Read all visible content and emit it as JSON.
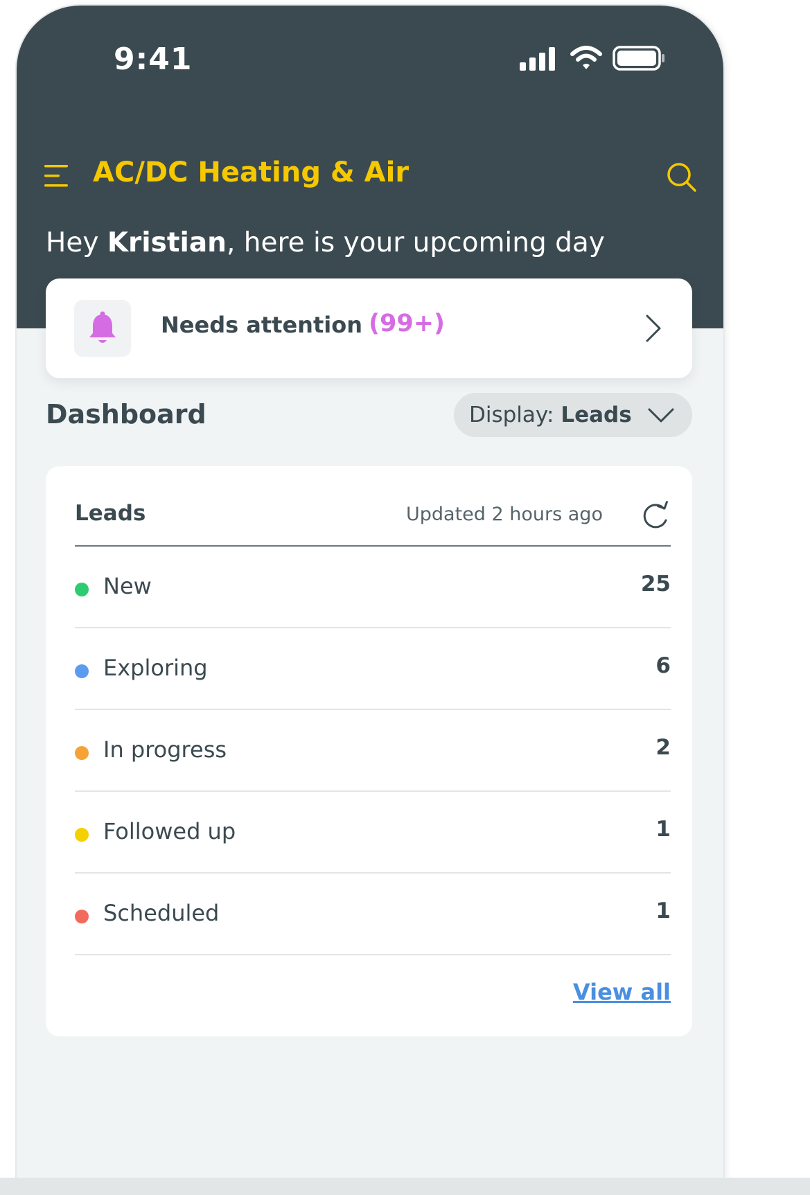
{
  "status_bar": {
    "time": "9:41"
  },
  "header": {
    "app_title": "AC/DC Heating & Air",
    "greeting_prefix": "Hey ",
    "greeting_name": "Kristian",
    "greeting_suffix": ", here is your upcoming day"
  },
  "attention": {
    "label": "Needs attention",
    "count": "(99+)"
  },
  "dashboard": {
    "title": "Dashboard",
    "display_prefix": "Display: ",
    "display_value": "Leads"
  },
  "leads_card": {
    "title": "Leads",
    "updated": "Updated 2 hours ago",
    "rows": [
      {
        "label": "New",
        "count": "25",
        "color": "#2ecc71"
      },
      {
        "label": "Exploring",
        "count": "6",
        "color": "#5b9cf0"
      },
      {
        "label": "In progress",
        "count": "2",
        "color": "#f7a234"
      },
      {
        "label": "Followed up",
        "count": "1",
        "color": "#f5d000"
      },
      {
        "label": "Scheduled",
        "count": "1",
        "color": "#f26a5e"
      }
    ],
    "view_all": "View all"
  },
  "colors": {
    "header_bg": "#3b4a50",
    "brand_yellow": "#f5c800",
    "attention_pink": "#d66ce4",
    "link_blue": "#4a8fe0"
  },
  "icons": [
    "signal-icon",
    "wifi-icon",
    "battery-icon",
    "menu-icon",
    "search-icon",
    "bell-icon",
    "chevron-right-icon",
    "chevron-down-icon",
    "refresh-icon"
  ]
}
